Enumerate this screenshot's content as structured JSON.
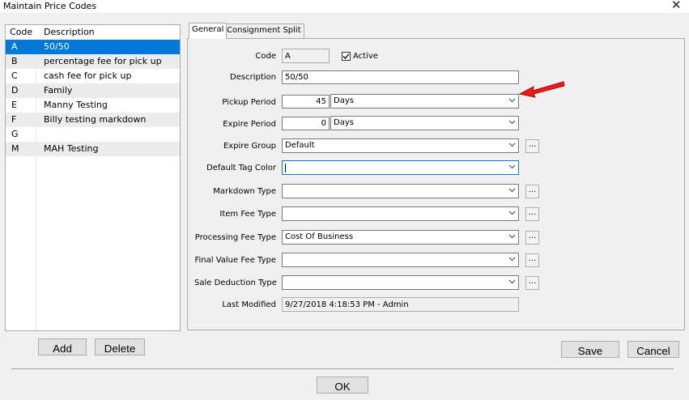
{
  "window": {
    "title": "Maintain Price Codes",
    "close_glyph": "✕"
  },
  "list": {
    "headers": {
      "code": "Code",
      "description": "Description"
    },
    "rows": [
      {
        "code": "A",
        "description": "50/50"
      },
      {
        "code": "B",
        "description": "percentage fee for pick up"
      },
      {
        "code": "C",
        "description": "cash fee for pick up"
      },
      {
        "code": "D",
        "description": "Family"
      },
      {
        "code": "E",
        "description": "Manny Testing"
      },
      {
        "code": "F",
        "description": "Billy testing markdown"
      },
      {
        "code": "G",
        "description": ""
      },
      {
        "code": "M",
        "description": "MAH Testing"
      }
    ],
    "selected_index": 0
  },
  "buttons": {
    "add": "Add",
    "delete": "Delete",
    "save": "Save",
    "cancel": "Cancel",
    "ok": "OK",
    "ellipsis": "..."
  },
  "tabs": {
    "general": "General",
    "consignment_split": "Consignment Split",
    "active": "General"
  },
  "form": {
    "code": {
      "label": "Code",
      "value": "A"
    },
    "active": {
      "label": "Active",
      "checked": true
    },
    "description": {
      "label": "Description",
      "value": "50/50"
    },
    "pickup_period": {
      "label": "Pickup Period",
      "value": "45",
      "unit": "Days"
    },
    "expire_period": {
      "label": "Expire Period",
      "value": "0",
      "unit": "Days"
    },
    "expire_group": {
      "label": "Expire Group",
      "value": "Default"
    },
    "default_tag_color": {
      "label": "Default Tag Color",
      "value": ""
    },
    "markdown_type": {
      "label": "Markdown Type",
      "value": ""
    },
    "item_fee_type": {
      "label": "Item Fee Type",
      "value": ""
    },
    "processing_fee_type": {
      "label": "Processing Fee Type",
      "value": "Cost Of Business"
    },
    "final_value_fee_type": {
      "label": "Final Value Fee Type",
      "value": ""
    },
    "sale_deduction_type": {
      "label": "Sale Deduction Type",
      "value": ""
    },
    "last_modified": {
      "label": "Last Modified",
      "value": "9/27/2018 4:18:53 PM - Admin"
    }
  },
  "colors": {
    "selection": "#0078d7",
    "arrow": "#e81e1e",
    "focus": "#0078d7"
  },
  "icons": {
    "dropdown": "chevron-down-icon",
    "close": "close-icon",
    "check": "check-icon",
    "annotation": "red-arrow-icon"
  }
}
